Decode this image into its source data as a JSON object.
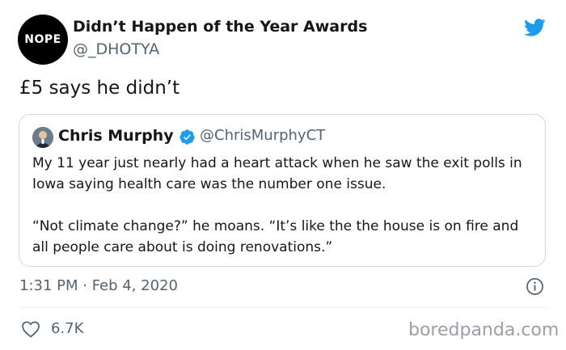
{
  "author": {
    "avatar_text": "NOPE",
    "display_name": "Didn’t Happen of the Year Awards",
    "handle": "@_DHOTYA"
  },
  "tweet": {
    "text": "£5 says he didn’t"
  },
  "quoted_tweet": {
    "display_name": "Chris Murphy",
    "handle": "@ChrisMurphyCT",
    "paragraphs": [
      "My 11 year just nearly had a heart attack when he saw the exit polls in Iowa saying health care was the number one issue.",
      "“Not climate change?” he moans. “It’s like the the house is on fire and all people care about is doing renovations.”"
    ]
  },
  "meta": {
    "timestamp": "1:31 PM · Feb 4, 2020",
    "like_count": "6.7K"
  },
  "watermark": "boredpanda.com",
  "colors": {
    "twitter_blue": "#1d9bf0",
    "text_primary": "#14171a",
    "text_secondary": "#536471",
    "border": "#cfd9de"
  },
  "icons": {
    "brand": "twitter-bird-icon",
    "verified": "verified-badge-icon",
    "info": "info-icon",
    "like": "heart-icon"
  }
}
